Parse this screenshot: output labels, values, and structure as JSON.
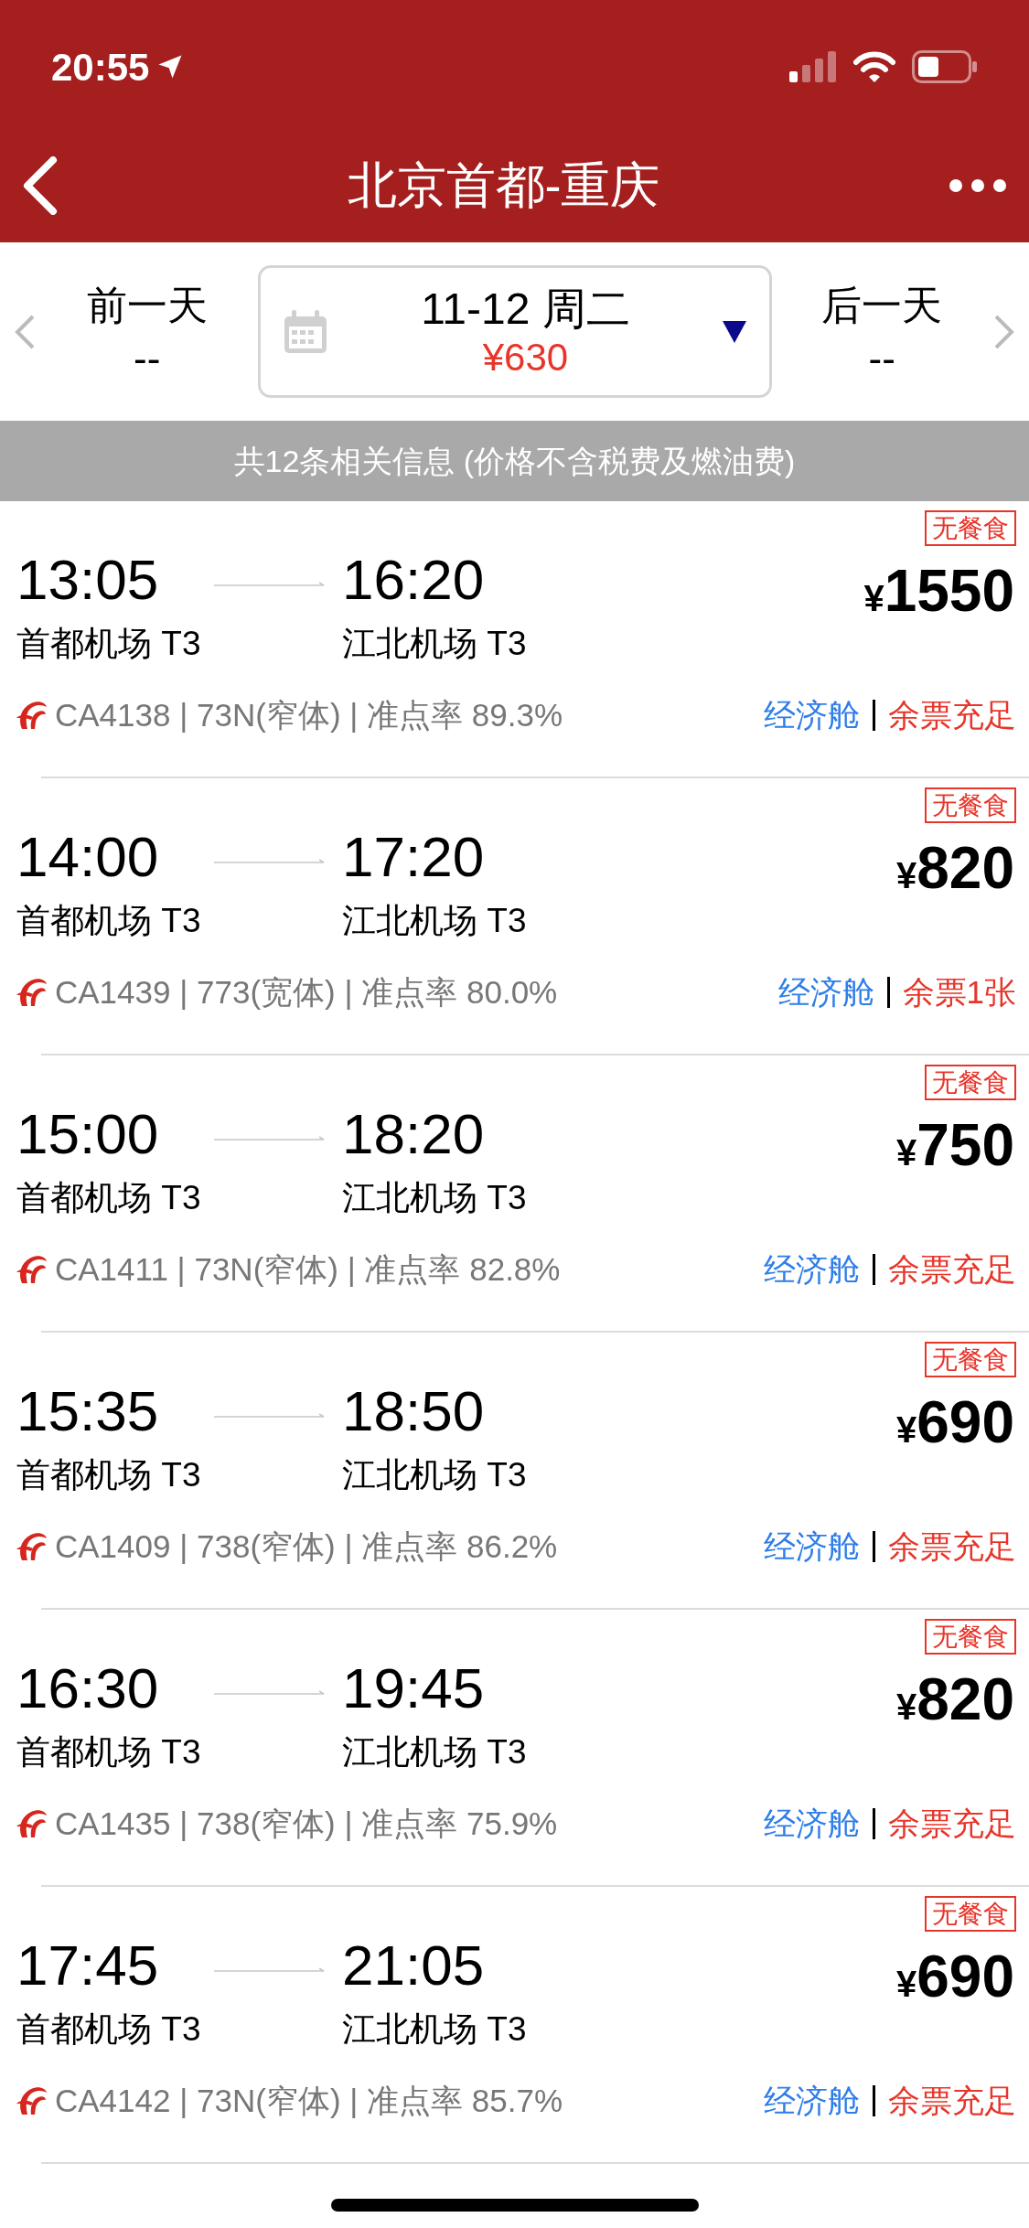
{
  "status_bar": {
    "time": "20:55"
  },
  "nav": {
    "title": "北京首都-重庆"
  },
  "date_bar": {
    "prev": {
      "label": "前一天",
      "price": "--"
    },
    "current": {
      "date": "11-12 周二",
      "price": "¥630"
    },
    "next": {
      "label": "后一天",
      "price": "--"
    }
  },
  "notice": "共12条相关信息 (价格不含税费及燃油费)",
  "flights": [
    {
      "depart": "13:05",
      "arrive": "16:20",
      "from": "首都机场 T3",
      "to": "江北机场 T3",
      "tag": "无餐食",
      "price": "1550",
      "currency": "¥",
      "info": "CA4138 | 73N(窄体) | 准点率 89.3%",
      "cabin": "经济舱",
      "seats": "余票充足"
    },
    {
      "depart": "14:00",
      "arrive": "17:20",
      "from": "首都机场 T3",
      "to": "江北机场 T3",
      "tag": "无餐食",
      "price": "820",
      "currency": "¥",
      "info": "CA1439 | 773(宽体) | 准点率 80.0%",
      "cabin": "经济舱",
      "seats": "余票1张"
    },
    {
      "depart": "15:00",
      "arrive": "18:20",
      "from": "首都机场 T3",
      "to": "江北机场 T3",
      "tag": "无餐食",
      "price": "750",
      "currency": "¥",
      "info": "CA1411 | 73N(窄体) | 准点率 82.8%",
      "cabin": "经济舱",
      "seats": "余票充足"
    },
    {
      "depart": "15:35",
      "arrive": "18:50",
      "from": "首都机场 T3",
      "to": "江北机场 T3",
      "tag": "无餐食",
      "price": "690",
      "currency": "¥",
      "info": "CA1409 | 738(窄体) | 准点率 86.2%",
      "cabin": "经济舱",
      "seats": "余票充足"
    },
    {
      "depart": "16:30",
      "arrive": "19:45",
      "from": "首都机场 T3",
      "to": "江北机场 T3",
      "tag": "无餐食",
      "price": "820",
      "currency": "¥",
      "info": "CA1435 | 738(窄体) | 准点率 75.9%",
      "cabin": "经济舱",
      "seats": "余票充足"
    },
    {
      "depart": "17:45",
      "arrive": "21:05",
      "from": "首都机场 T3",
      "to": "江北机场 T3",
      "tag": "无餐食",
      "price": "690",
      "currency": "¥",
      "info": "CA4142 | 73N(窄体) | 准点率 85.7%",
      "cabin": "经济舱",
      "seats": "余票充足"
    }
  ]
}
